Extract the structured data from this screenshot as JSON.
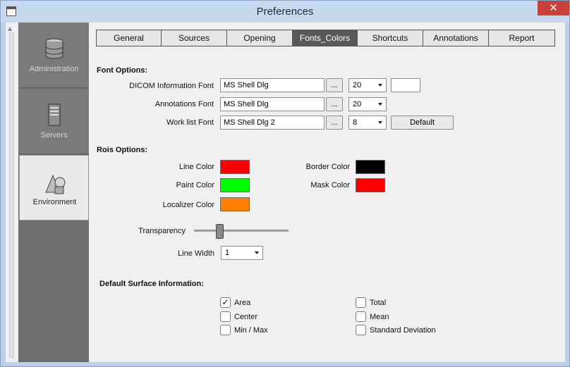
{
  "window": {
    "title": "Preferences",
    "close_glyph": "✕"
  },
  "nav": [
    {
      "label": "Administration",
      "icon": "database-icon"
    },
    {
      "label": "Servers",
      "icon": "server-icon"
    },
    {
      "label": "Environment",
      "icon": "shapes-icon"
    }
  ],
  "tabs": [
    "General",
    "Sources",
    "Opening",
    "Fonts_Colors",
    "Shortcuts",
    "Annotations",
    "Report"
  ],
  "active_tab": "Fonts_Colors",
  "font_options": {
    "heading": "Font Options:",
    "dicom_label": "DICOM Information Font",
    "dicom_font": "MS Shell Dlg",
    "dicom_size": "20",
    "annotations_label": "Annotations Font",
    "annotations_font": "MS Shell Dlg",
    "annotations_size": "20",
    "worklist_label": "Work list Font",
    "worklist_font": "MS Shell Dlg 2",
    "worklist_size": "8",
    "browse_label": "...",
    "default_button": "Default"
  },
  "rois": {
    "heading": "Rois Options:",
    "line_color_label": "Line Color",
    "line_color": "#ff0000",
    "paint_color_label": "Paint Color",
    "paint_color": "#00ff00",
    "localizer_color_label": "Localizer Color",
    "localizer_color": "#ff8000",
    "border_color_label": "Border Color",
    "border_color": "#000000",
    "mask_color_label": "Mask Color",
    "mask_color": "#ff0000",
    "transparency_label": "Transparency",
    "transparency_value": 0.25,
    "line_width_label": "Line Width",
    "line_width": "1"
  },
  "surface": {
    "heading": "Default Surface Information:",
    "checkmark": "✓",
    "items": [
      {
        "label": "Area",
        "checked": true
      },
      {
        "label": "Center",
        "checked": false
      },
      {
        "label": "Min / Max",
        "checked": false
      },
      {
        "label": "Total",
        "checked": false
      },
      {
        "label": "Mean",
        "checked": false
      },
      {
        "label": "Standard Deviation",
        "checked": false
      }
    ]
  }
}
